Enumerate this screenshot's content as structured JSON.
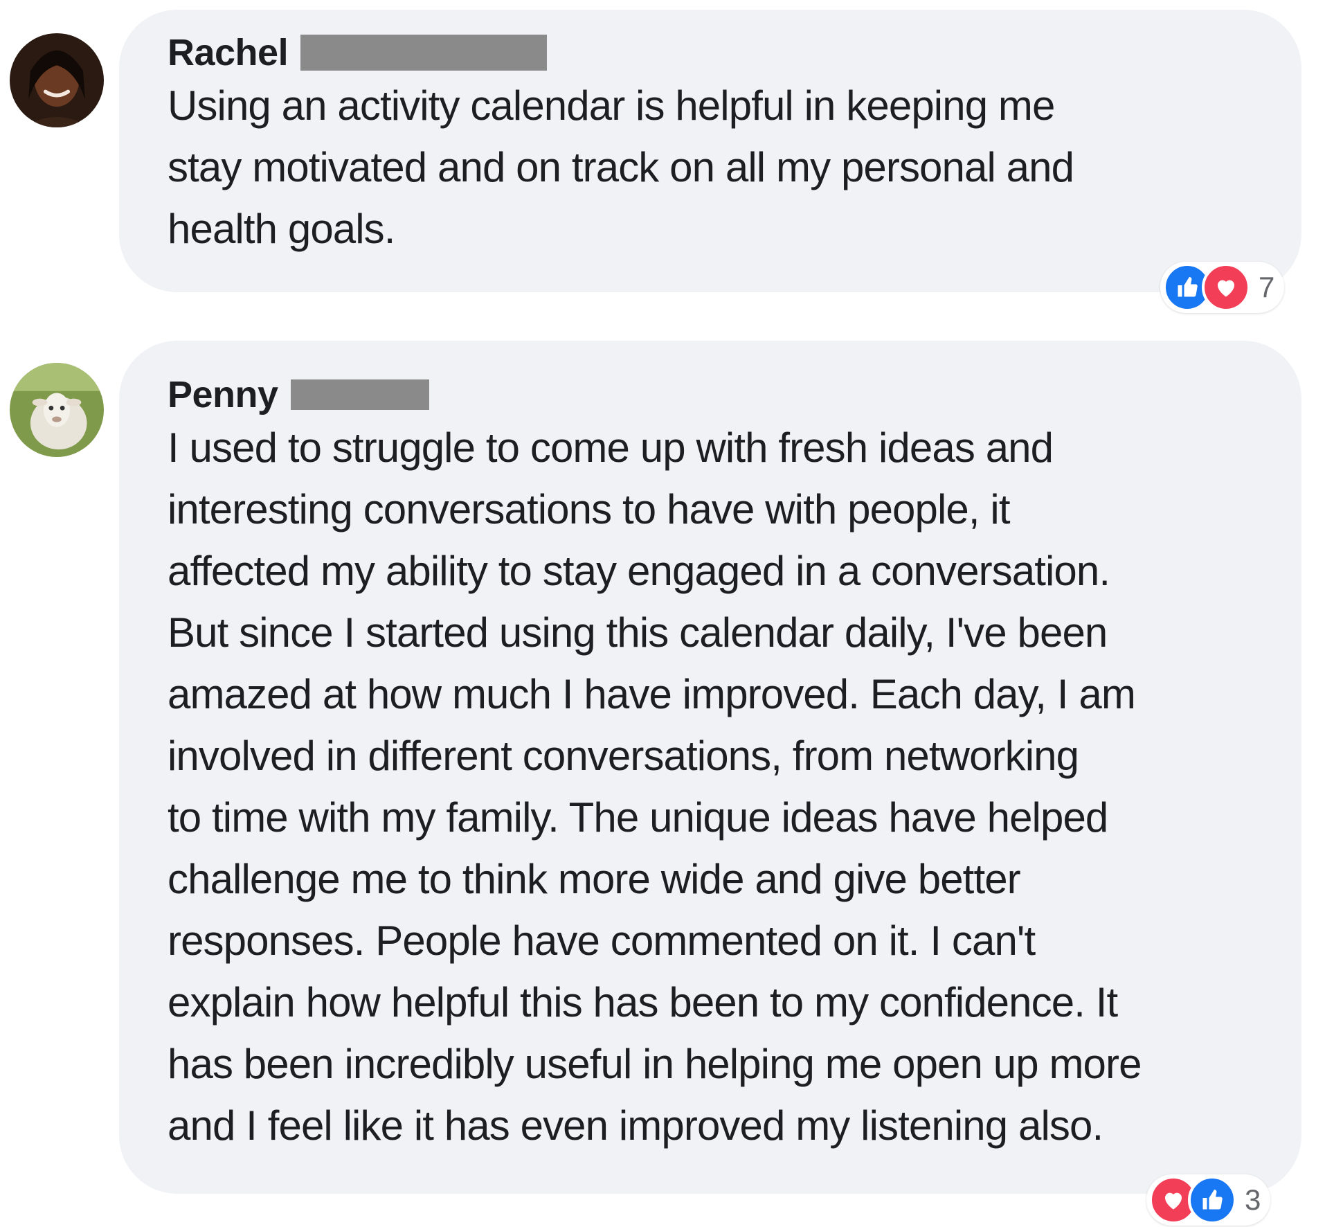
{
  "comments": [
    {
      "author": "Rachel",
      "text": "Using an activity calendar is helpful in keeping me\nstay motivated and on track  on all my personal and\nhealth goals.",
      "reactions": [
        "like",
        "love"
      ],
      "reaction_count": "7"
    },
    {
      "author": "Penny",
      "text": "I used to struggle to come up with fresh ideas and\ninteresting conversations to have with people, it\naffected my ability to stay engaged in a conversation.\nBut since I started using this calendar daily, I've been\namazed at how much I have improved. Each day, I am\ninvolved in different conversations, from networking\nto time with my family. The unique ideas have helped\nchallenge me to think more wide and give better\nresponses. People have commented on it. I can't\nexplain how helpful this has been to my confidence. It\nhas been incredibly useful in helping me open up more\nand I feel like it has even improved my listening also.",
      "reactions": [
        "love",
        "like"
      ],
      "reaction_count": "3"
    }
  ],
  "colors": {
    "bubble_bg": "#f0f2f5",
    "like_blue": "#1877f2",
    "love_red": "#f33e58",
    "redaction_gray": "#8a8a8a"
  }
}
